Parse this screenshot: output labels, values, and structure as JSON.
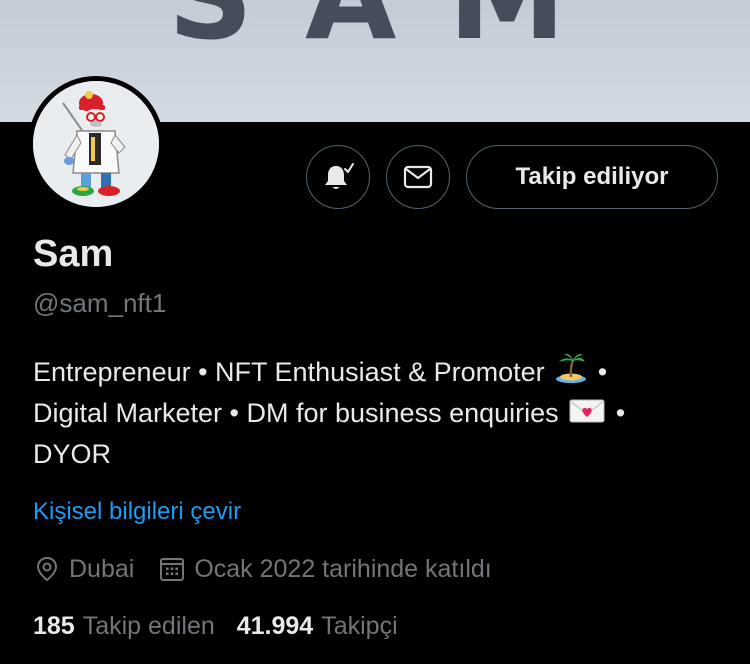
{
  "banner": {
    "text": "SAM"
  },
  "profile": {
    "display_name": "Sam",
    "handle": "@sam_nft1",
    "bio_lines": [
      "Entrepreneur • NFT Enthusiast & Promoter",
      "Digital Marketer • DM for business enquiries",
      "DYOR"
    ],
    "bio_separator": "•",
    "translate_label": "Kişisel bilgileri çevir",
    "location": "Dubai",
    "joined": "Ocak 2022 tarihinde katıldı"
  },
  "actions": {
    "notify_icon": "bell-check-icon",
    "message_icon": "envelope-icon",
    "follow_label": "Takip ediliyor"
  },
  "stats": {
    "following_count": "185",
    "following_label": "Takip edilen",
    "followers_count": "41.994",
    "followers_label": "Takipçi"
  },
  "colors": {
    "background": "#000000",
    "text": "#e7e9ea",
    "secondary_text": "#71767b",
    "link": "#1d9bf0",
    "border": "#536471",
    "banner": "#c9d1da"
  }
}
